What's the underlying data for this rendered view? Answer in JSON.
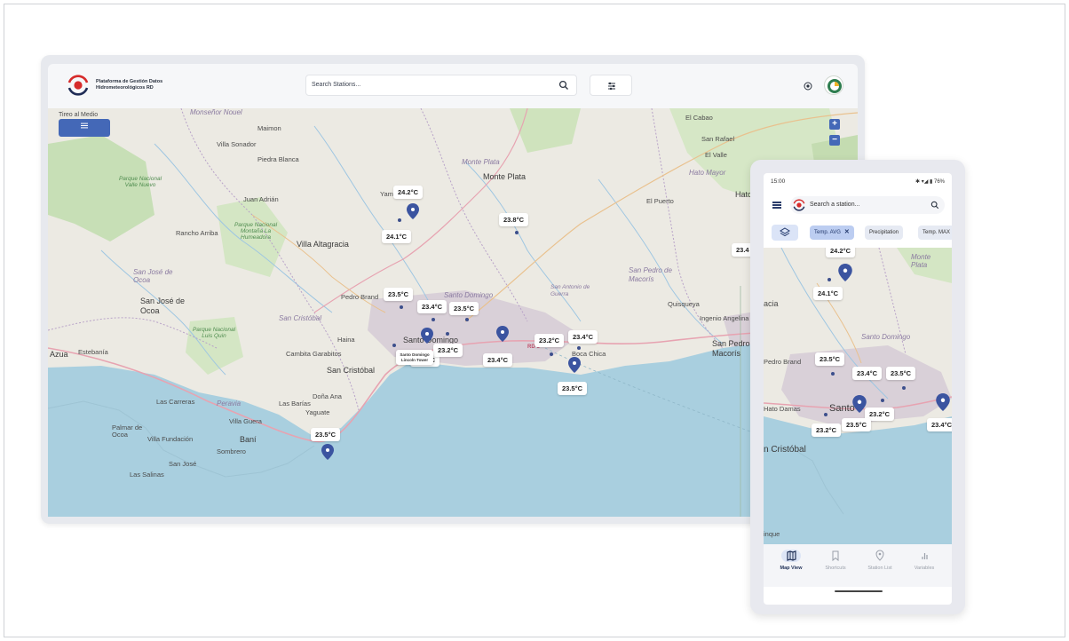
{
  "desktop": {
    "brand_text": "Plataforma de Gestión Datos Hidrometeorológicos RD",
    "search_placeholder": "Search Stations...",
    "map_corner_label": "Tireo al Medio",
    "places": {
      "monsenor_nouel": "Monseñor Nouel",
      "maimon": "Maimon",
      "villa_sonador": "Villa Sonador",
      "piedra_blanca": "Piedra Blanca",
      "juan_adrian": "Juan Adrián",
      "rancho_arriba": "Rancho Arriba",
      "villa_altagracia": "Villa Altagracia",
      "san_jose_ocoa_prov": "San José de Ocoa",
      "san_jose_ocoa": "San José de Ocoa",
      "azua": "Azua",
      "estebania": "Estebanía",
      "sabana_yegua": "Yaguate",
      "san_cristobal_prov": "San Cristóbal",
      "san_cristobal": "San Cristóbal",
      "cambita": "Cambita Garabitos",
      "haina": "Haina",
      "dona_ana": "Doña Ana",
      "yaguate": "Yaguate",
      "peravia": "Peravia",
      "villa_guera": "Villa Guera",
      "las_carreras": "Las Carreras",
      "las_barias": "Las Barías",
      "bani": "Baní",
      "sombrero": "Sombrero",
      "palmar_de_ocoa": "Palmar de Ocoa",
      "villa_fundacion": "Villa Fundación",
      "san_jose": "San José",
      "las_salinas": "Las Salinas",
      "monte_plata_prov": "Monte Plata",
      "monte_plata": "Monte Plata",
      "yamasa": "Yamasá",
      "santo_domingo_prov": "Santo Domingo",
      "santo_domingo": "Santo Domingo",
      "pedro_brand": "Pedro Brand",
      "san_antonio_guerra": "San Antonio de Guerra",
      "boca_chica": "Boca Chica",
      "el_puerto": "El Puerto",
      "hato_mayor_prov": "Hato Mayor",
      "hato_mayor": "Hato Mayor",
      "san_pedro_prov": "San Pedro de Macorís",
      "quisqueya": "Quisqueya",
      "ingenio_angelina": "Ingenio Angelina",
      "el_cabao": "El Cabao",
      "san_rafael": "San Rafael",
      "el_valle": "El Valle",
      "san_pedro": "San Pedro de Macorís",
      "parque_valle_nuevo": "Parque Nacional Valle Nuevo",
      "parque_humeadora": "Parque Nacional Montaña La Humeadora",
      "parque_luis_quin": "Parque Nacional Luis Quin",
      "road_rd3": "RD-3"
    },
    "temps": [
      "24.2°C",
      "24.1°C",
      "23.8°C",
      "23.5°C",
      "23.4°C",
      "23.5°C",
      "23.5°C",
      "23.2°C",
      "23.4°C",
      "23.2°C",
      "23.4°C",
      "23.5°C",
      "23.5°C",
      "23.4"
    ],
    "tooltip_text": "Santo Domingo Lincoln Tower"
  },
  "phone": {
    "time": "15:00",
    "status_right": "✱ ▾◢ ▮ 76%",
    "search_placeholder": "Search a station...",
    "chips": [
      "Temp. AVG",
      "Precipitation",
      "Temp. MAX"
    ],
    "places": {
      "acia": "acia",
      "santo_domingo_prov": "Santo Domingo",
      "monte_plata": "Monte Plata",
      "pedro_brand": "Pedro Brand",
      "haina": "Hato Damas",
      "santo": "Santo",
      "cristobal": "n Cristóbal",
      "inque": "inque"
    },
    "temps": [
      "24.2°C",
      "24.1°C",
      "23.5°C",
      "23.4°C",
      "23.5°C",
      "23.2°C",
      "23.2°C",
      "23.5°C",
      "23.4°C"
    ],
    "nav": [
      "Map View",
      "Shortcuts",
      "Station List",
      "Variables"
    ]
  },
  "colors": {
    "accent": "#4468b7",
    "pin": "#3b54a0",
    "sea": "#a9cfdf",
    "brand_red": "#d62b2b"
  }
}
